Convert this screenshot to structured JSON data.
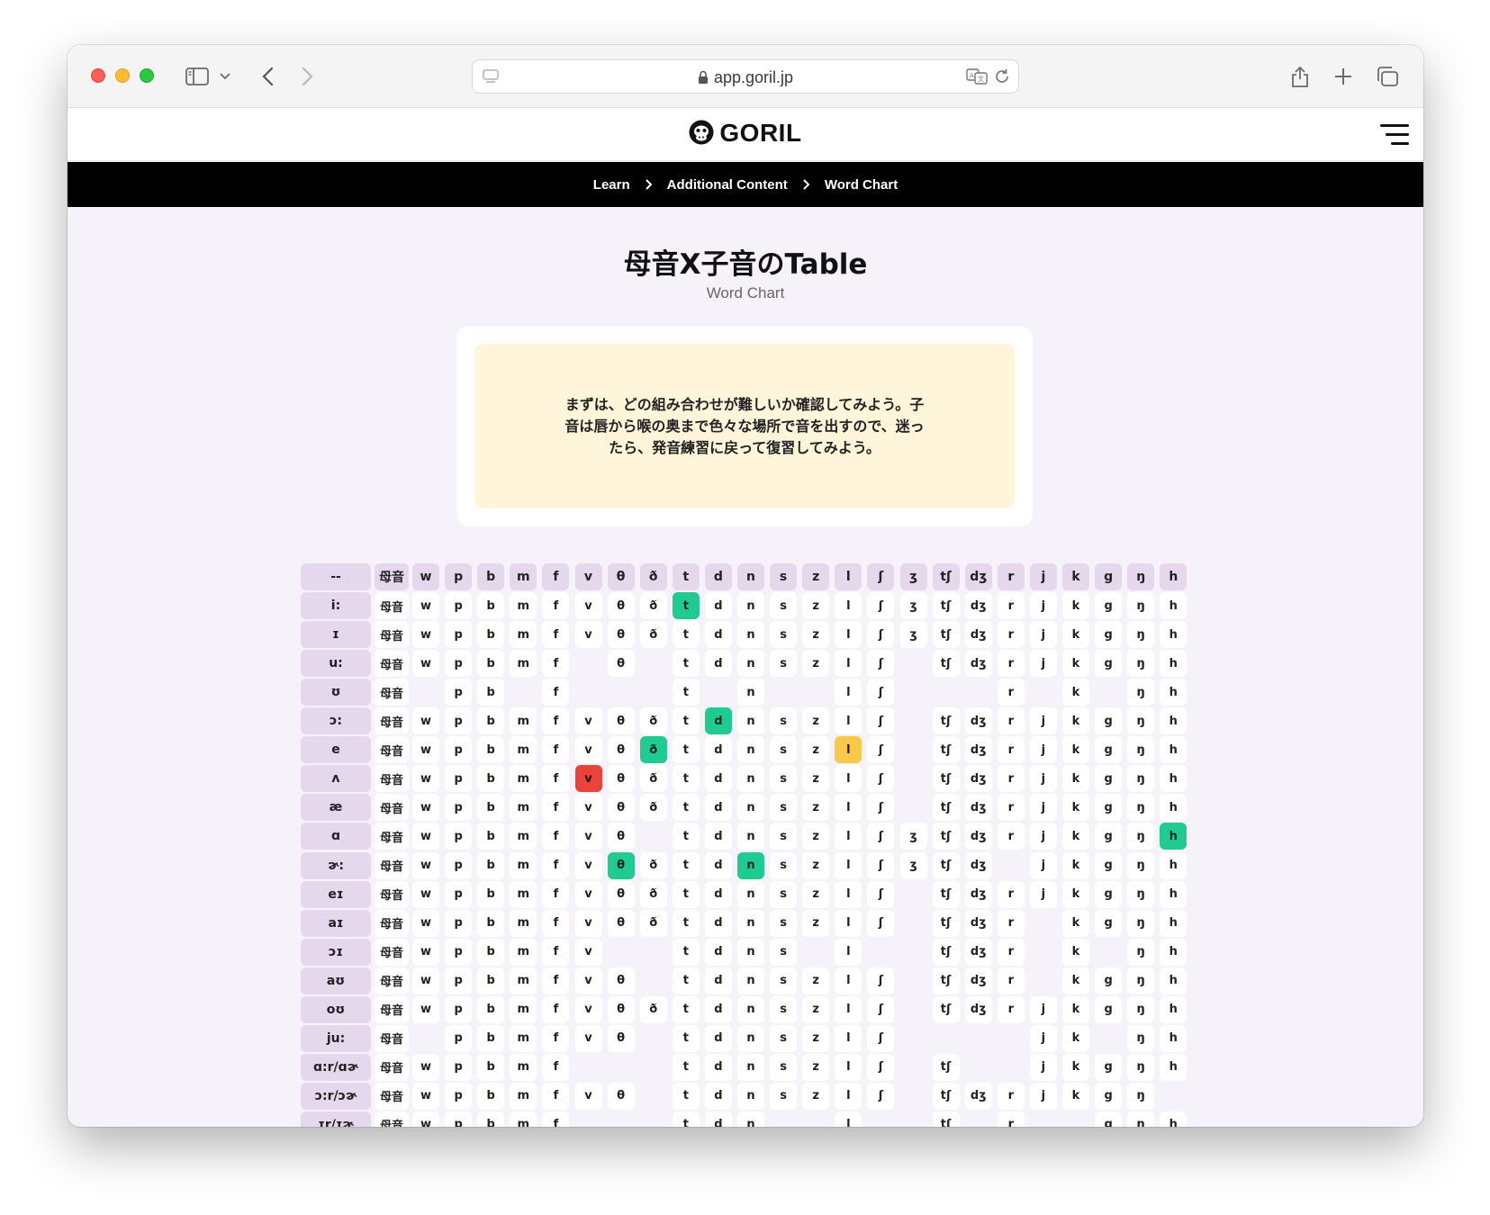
{
  "browser": {
    "url": "app.goril.jp"
  },
  "site": {
    "logo": "GORIL",
    "menu_icon": "hamburger-icon"
  },
  "breadcrumb": [
    "Learn",
    "Additional Content",
    "Word Chart"
  ],
  "page": {
    "title": "母音X子音のTable",
    "subtitle": "Word Chart",
    "notice": "まずは、どの組み合わせが難しいか確認してみよう。子音は唇から喉の奥まで色々な場所で音を出すので、迷ったら、発音練習に戻って復習してみよう。"
  },
  "colors": {
    "green": "#1fcb90",
    "red": "#e9433a",
    "yellow": "#fcc84a",
    "header_bg": "#e5d7ec",
    "notice_bg": "#fff5da"
  },
  "chart": {
    "corner_label": "--",
    "vowel_label": "母音",
    "consonants": [
      "w",
      "p",
      "b",
      "m",
      "f",
      "v",
      "θ",
      "ð",
      "t",
      "d",
      "n",
      "s",
      "z",
      "l",
      "ʃ",
      "ʒ",
      "tʃ",
      "dʒ",
      "r",
      "j",
      "k",
      "g",
      "ŋ",
      "h"
    ],
    "rows": [
      {
        "vowel": "i:",
        "available": "111111111111111111111111",
        "highlight": {
          "t": "green"
        }
      },
      {
        "vowel": "ɪ",
        "available": "111111111111111111111111",
        "highlight": {}
      },
      {
        "vowel": "u:",
        "available": "111110101111111011111111",
        "highlight": {}
      },
      {
        "vowel": "ʊ",
        "available": "011010001010011000101011",
        "highlight": {}
      },
      {
        "vowel": "ɔ:",
        "available": "111111111111111011111111",
        "highlight": {
          "d": "green"
        }
      },
      {
        "vowel": "e",
        "available": "111111111111111011111111",
        "highlight": {
          "ð": "green",
          "l": "yellow"
        }
      },
      {
        "vowel": "ʌ",
        "available": "111111111111111011111111",
        "highlight": {
          "v": "red"
        }
      },
      {
        "vowel": "æ",
        "available": "111111111111111011111111",
        "highlight": {}
      },
      {
        "vowel": "ɑ",
        "available": "111111101111111111111111",
        "highlight": {
          "h": "green"
        }
      },
      {
        "vowel": "ɚ:",
        "available": "111111111111111111011111",
        "highlight": {
          "θ": "green",
          "n": "green"
        }
      },
      {
        "vowel": "eɪ",
        "available": "111111111111111011111111",
        "highlight": {}
      },
      {
        "vowel": "aɪ",
        "available": "111111111111111011101111",
        "highlight": {}
      },
      {
        "vowel": "ɔɪ",
        "available": "111111001111010011101011",
        "highlight": {}
      },
      {
        "vowel": "aʊ",
        "available": "111111101111111011101111",
        "highlight": {}
      },
      {
        "vowel": "oʊ",
        "available": "111111111111111011111111",
        "highlight": {}
      },
      {
        "vowel": "ju:",
        "available": "011111101111111000011011",
        "highlight": {}
      },
      {
        "vowel": "ɑ:r/ɑɚ",
        "available": "111110001111111010011111",
        "highlight": {}
      },
      {
        "vowel": "ɔ:r/ɔɚ",
        "available": "111111101111111011111110",
        "highlight": {}
      },
      {
        "vowel": "ɪr/ɪɚ",
        "available": "111110001110010010100111",
        "highlight": {}
      }
    ]
  }
}
